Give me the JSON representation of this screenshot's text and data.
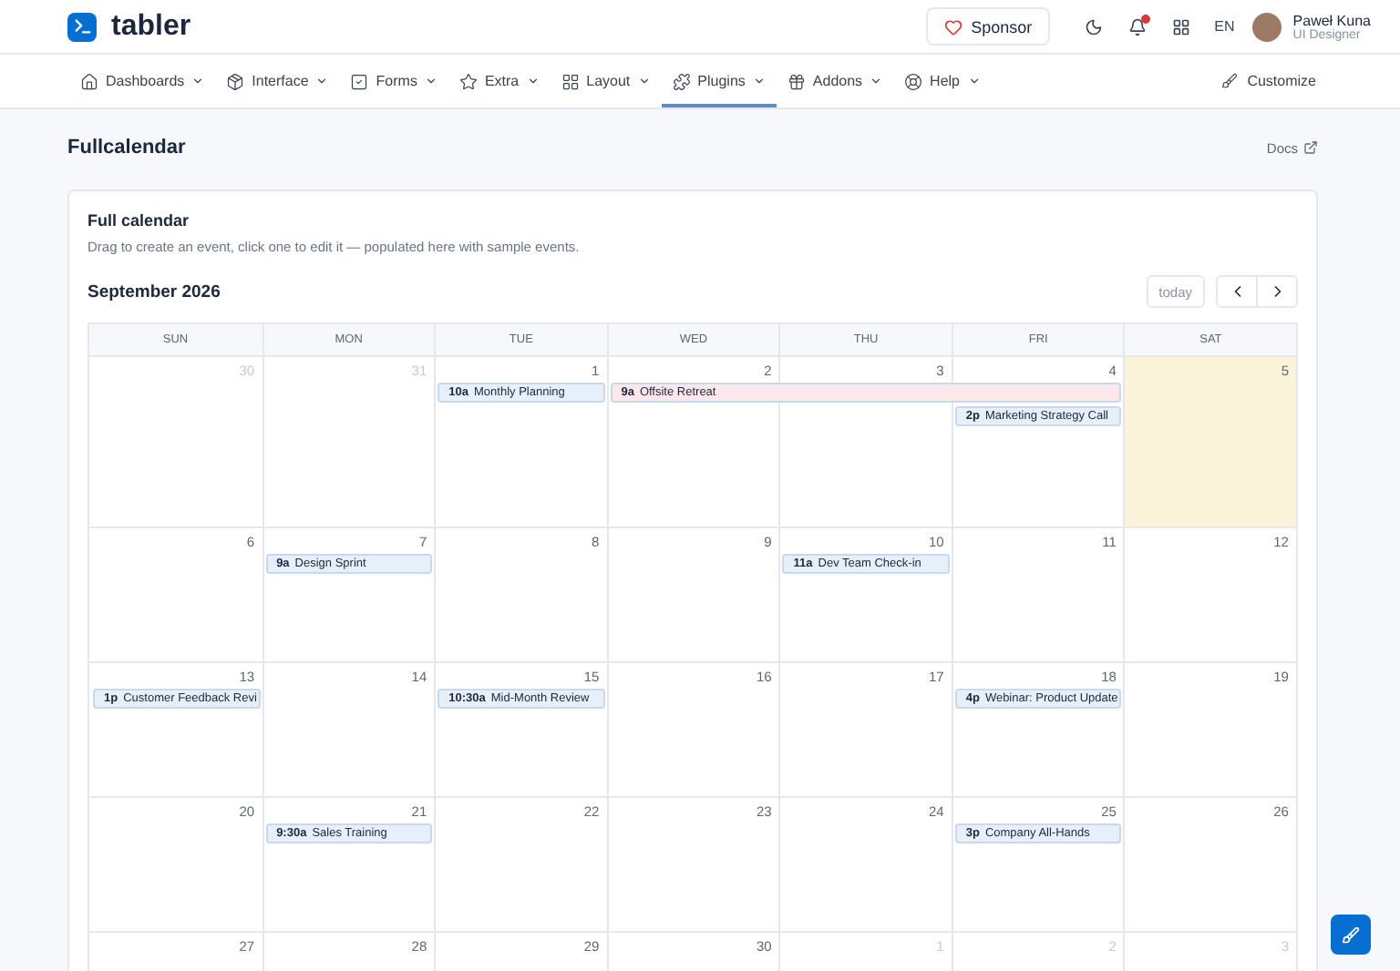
{
  "brand": {
    "name": "tabler"
  },
  "header": {
    "sponsor": "Sponsor",
    "notifications_unread": true,
    "language": "EN",
    "user": {
      "name": "Paweł Kuna",
      "role": "UI Designer"
    }
  },
  "nav": [
    {
      "label": "Dashboards",
      "kind": "home",
      "selected": false
    },
    {
      "label": "Interface",
      "kind": "package",
      "selected": false
    },
    {
      "label": "Forms",
      "kind": "check",
      "selected": false
    },
    {
      "label": "Extra",
      "kind": "star",
      "selected": false
    },
    {
      "label": "Layout",
      "kind": "grid",
      "selected": false
    },
    {
      "label": "Plugins",
      "kind": "puzzle",
      "selected": true
    },
    {
      "label": "Addons",
      "kind": "gift",
      "selected": false
    },
    {
      "label": "Help",
      "kind": "lifebuoy",
      "selected": false
    }
  ],
  "customize": "Customize",
  "page": {
    "title": "Fullcalendar",
    "docs": "Docs"
  },
  "card": {
    "title": "Full calendar",
    "subtitle": "Drag to create an event, click one to edit it — populated here with sample events."
  },
  "calendar": {
    "month": "September 2026",
    "today_button": "today",
    "weekdays": [
      "SUN",
      "MON",
      "TUE",
      "WED",
      "THU",
      "FRI",
      "SAT"
    ],
    "weeks": [
      {
        "days": [
          {
            "n": "30",
            "other_month": true,
            "today": false
          },
          {
            "n": "31",
            "other_month": true,
            "today": false
          },
          {
            "n": "1",
            "other_month": false,
            "today": false,
            "events": [
              {
                "kind": "event",
                "time": "10a",
                "title": "Monthly Planning",
                "color": "#e7f0fa"
              }
            ]
          },
          {
            "n": "2",
            "other_month": false,
            "today": false,
            "events": [
              {
                "kind": "event",
                "time": "9a",
                "title": "Offsite Retreat",
                "color": "#fce8ea"
              }
            ]
          },
          {
            "n": "3",
            "other_month": false,
            "today": false,
            "events": [
              {
                "kind": "continuation"
              }
            ]
          },
          {
            "n": "4",
            "other_month": false,
            "today": false,
            "events": [
              {
                "kind": "continuation"
              },
              {
                "kind": "event",
                "time": "2p",
                "title": "Marketing Strategy Call",
                "color": "#e7f0fa"
              }
            ]
          },
          {
            "n": "5",
            "other_month": false,
            "today": true
          }
        ]
      },
      {
        "days": [
          {
            "n": "6",
            "other_month": false,
            "today": false
          },
          {
            "n": "7",
            "other_month": false,
            "today": false,
            "events": [
              {
                "kind": "event",
                "time": "9a",
                "title": "Design Sprint",
                "color": "#e7f0fa"
              }
            ]
          },
          {
            "n": "8",
            "other_month": false,
            "today": false
          },
          {
            "n": "9",
            "other_month": false,
            "today": false
          },
          {
            "n": "10",
            "other_month": false,
            "today": false,
            "events": [
              {
                "kind": "event",
                "time": "11a",
                "title": "Dev Team Check-in",
                "color": "#e7f0fa"
              }
            ]
          },
          {
            "n": "11",
            "other_month": false,
            "today": false
          },
          {
            "n": "12",
            "other_month": false,
            "today": false
          }
        ]
      },
      {
        "days": [
          {
            "n": "13",
            "other_month": false,
            "today": false,
            "events": [
              {
                "kind": "event",
                "time": "1p",
                "title": "Customer Feedback Revi",
                "color": "#e7f0fa"
              }
            ]
          },
          {
            "n": "14",
            "other_month": false,
            "today": false
          },
          {
            "n": "15",
            "other_month": false,
            "today": false,
            "events": [
              {
                "kind": "event",
                "time": "10:30a",
                "title": "Mid-Month Review",
                "color": "#e7f0fa"
              }
            ]
          },
          {
            "n": "16",
            "other_month": false,
            "today": false
          },
          {
            "n": "17",
            "other_month": false,
            "today": false
          },
          {
            "n": "18",
            "other_month": false,
            "today": false,
            "events": [
              {
                "kind": "event",
                "time": "4p",
                "title": "Webinar: Product Update",
                "color": "#e7f0fa"
              }
            ]
          },
          {
            "n": "19",
            "other_month": false,
            "today": false
          }
        ]
      },
      {
        "days": [
          {
            "n": "20",
            "other_month": false,
            "today": false
          },
          {
            "n": "21",
            "other_month": false,
            "today": false,
            "events": [
              {
                "kind": "event",
                "time": "9:30a",
                "title": "Sales Training",
                "color": "#e7f0fa"
              }
            ]
          },
          {
            "n": "22",
            "other_month": false,
            "today": false
          },
          {
            "n": "23",
            "other_month": false,
            "today": false
          },
          {
            "n": "24",
            "other_month": false,
            "today": false
          },
          {
            "n": "25",
            "other_month": false,
            "today": false,
            "events": [
              {
                "kind": "event",
                "time": "3p",
                "title": "Company All-Hands",
                "color": "#e7f0fa"
              }
            ]
          },
          {
            "n": "26",
            "other_month": false,
            "today": false
          }
        ]
      },
      {
        "days": [
          {
            "n": "27",
            "other_month": false,
            "today": false
          },
          {
            "n": "28",
            "other_month": false,
            "today": false
          },
          {
            "n": "29",
            "other_month": false,
            "today": false
          },
          {
            "n": "30",
            "other_month": false,
            "today": false
          },
          {
            "n": "1",
            "other_month": true,
            "today": false
          },
          {
            "n": "2",
            "other_month": true,
            "today": false
          },
          {
            "n": "3",
            "other_month": true,
            "today": false
          }
        ]
      }
    ]
  }
}
